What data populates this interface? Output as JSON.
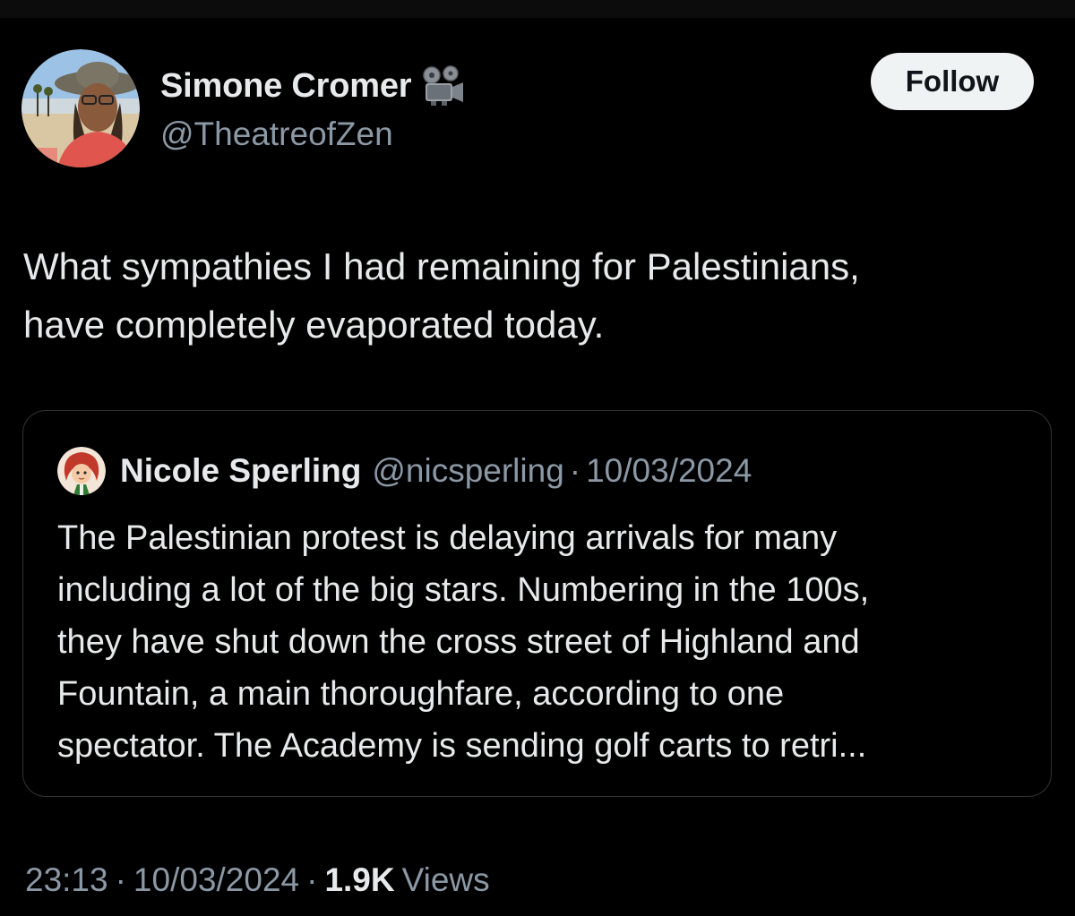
{
  "author": {
    "display_name": "Simone Cromer",
    "handle": "@TheatreofZen",
    "badge_icon": "film-projector-icon",
    "avatar_icon": "user-avatar-photo"
  },
  "follow_button": {
    "label": "Follow"
  },
  "tweet": {
    "text": "What sympathies I had remaining for Palestinians,\nhave completely evaporated today.",
    "time": "23:13",
    "date": "10/03/2024",
    "separator": "·",
    "views_count": "1.9K",
    "views_label": "Views"
  },
  "quoted_tweet": {
    "display_name": "Nicole Sperling",
    "handle": "@nicsperling",
    "separator": "·",
    "date": "10/03/2024",
    "avatar_icon": "cartoon-avatar-icon",
    "text": "The Palestinian protest is delaying arrivals for many\nincluding a lot of the big stars. Numbering in the 100s,\nthey have shut down the cross street of Highland and\nFountain, a main thoroughfare, according to one\nspectator. The Academy is sending golf carts to retri..."
  },
  "colors": {
    "background": "#000000",
    "primary_text": "#e7e9ea",
    "secondary_text": "#8b98a5",
    "border": "#2f3336",
    "follow_button_bg": "#eff3f4"
  }
}
